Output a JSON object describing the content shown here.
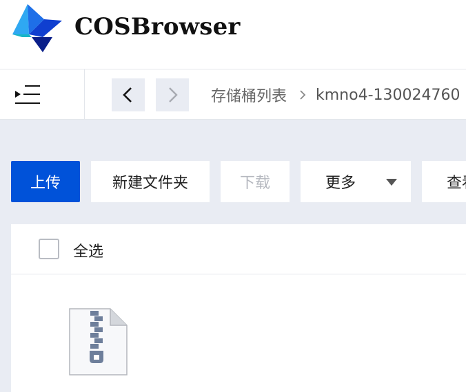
{
  "app": {
    "title": "COSBrowser"
  },
  "nav": {
    "breadcrumb": [
      "存储桶列表",
      "kmno4-130024760"
    ]
  },
  "toolbar": {
    "upload_label": "上传",
    "new_folder_label": "新建文件夹",
    "download_label": "下载",
    "more_label": "更多",
    "view_label": "查看"
  },
  "list": {
    "select_all_label": "全选",
    "select_all_checked": false,
    "items": [
      {
        "icon": "zip-file-icon"
      }
    ]
  },
  "colors": {
    "primary": "#0052d9",
    "disabled_text": "#b5b8bf",
    "page_bg": "#e9ecf3"
  }
}
